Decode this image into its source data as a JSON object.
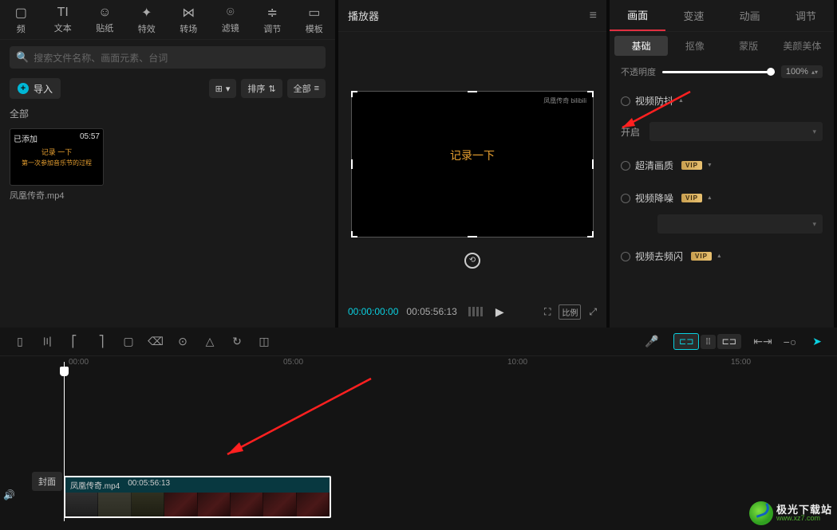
{
  "top_tabs": {
    "t0": "频",
    "t1": "文本",
    "t2": "贴纸",
    "t3": "特效",
    "t4": "转场",
    "t5": "滤镜",
    "t6": "调节",
    "t7": "模板"
  },
  "search": {
    "placeholder": "搜索文件名称、画面元素、台词"
  },
  "import": {
    "label": "导入"
  },
  "toolbar": {
    "view": "⊞",
    "sort": "排序",
    "all_dd": "全部"
  },
  "all_label": "全部",
  "media": {
    "tag": "已添加",
    "dur": "05:57",
    "l1": "记录 一下",
    "l2": "第一次参加音乐节的过程",
    "name": "凤凰传奇.mp4"
  },
  "preview": {
    "title": "播放器",
    "watermark": "凤凰传奇 bilibili",
    "caption": "记录一下",
    "time_cur": "00:00:00:00",
    "time_tot": "00:05:56:13",
    "ratio": "比例"
  },
  "right": {
    "tabs": {
      "t0": "画面",
      "t1": "变速",
      "t2": "动画",
      "t3": "调节"
    },
    "subtabs": {
      "s0": "基础",
      "s1": "抠像",
      "s2": "蒙版",
      "s3": "美颜美体"
    },
    "opacity": {
      "label": "不透明度",
      "value": "100%"
    },
    "stab": "视频防抖",
    "enable": "开启",
    "hd": "超清画质",
    "denoise": "视频降噪",
    "deflicker": "视频去频闪",
    "vip": "VIP"
  },
  "ruler": {
    "r0": "00:00",
    "r1": "05:00",
    "r2": "10:00",
    "r3": "15:00"
  },
  "clip": {
    "name": "凤凰传奇.mp4",
    "dur": "00:05:56:13"
  },
  "cover": "封面",
  "brand": {
    "name": "极光下载站",
    "url": "www.xz7.com"
  }
}
